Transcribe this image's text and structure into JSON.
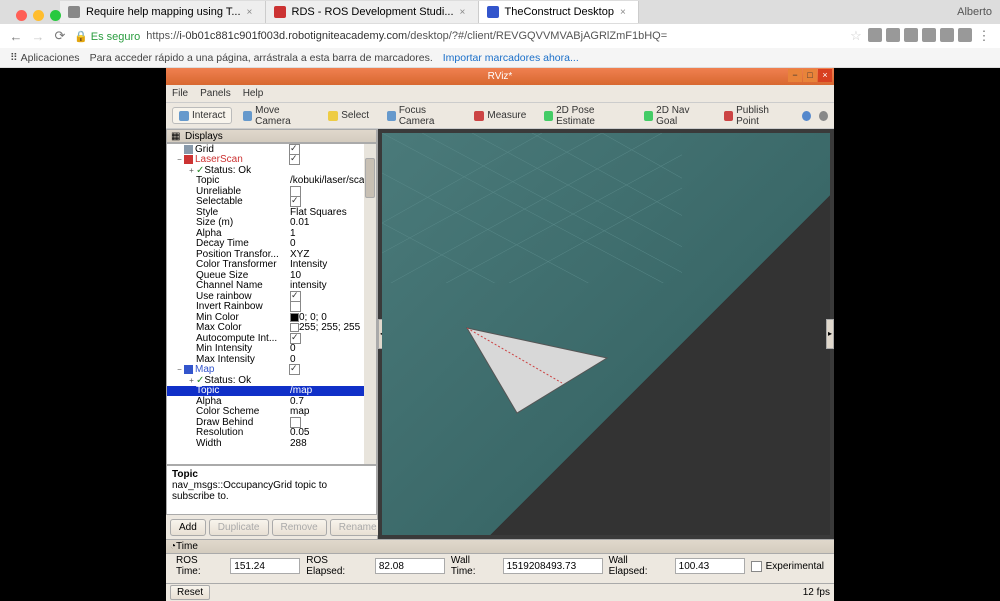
{
  "browser": {
    "user": "Alberto",
    "tabs": [
      {
        "label": "Require help mapping using T..."
      },
      {
        "label": "RDS - ROS Development Studi..."
      },
      {
        "label": "TheConstruct Desktop"
      }
    ],
    "secure_label": "Es seguro",
    "url_prefix": "https://",
    "url_host": "i-0b01c881c901f003d.robotigniteacademy.com",
    "url_path": "/desktop/?#/client/REVGQVVMVABjAGRlZmF1bHQ=",
    "bookmarks_apps": "Aplicaciones",
    "bookmarks_hint": "Para acceder rápido a una página, arrástrala a esta barra de marcadores.",
    "bookmarks_import": "Importar marcadores ahora..."
  },
  "rviz": {
    "title": "RViz*",
    "menus": [
      "File",
      "Panels",
      "Help"
    ],
    "tools": [
      {
        "label": "Interact",
        "color": "#6699cc",
        "active": true
      },
      {
        "label": "Move Camera",
        "color": "#6699cc"
      },
      {
        "label": "Select",
        "color": "#eecc44"
      },
      {
        "label": "Focus Camera",
        "color": "#6699cc"
      },
      {
        "label": "Measure",
        "color": "#cc4444"
      },
      {
        "label": "2D Pose Estimate",
        "color": "#44cc66"
      },
      {
        "label": "2D Nav Goal",
        "color": "#44cc66"
      },
      {
        "label": "Publish Point",
        "color": "#cc4444"
      }
    ],
    "displays_header": "Displays",
    "tree": [
      {
        "indent": 1,
        "label": "Grid",
        "type": "check",
        "checked": true,
        "icon": "#8899aa"
      },
      {
        "indent": 1,
        "label": "LaserScan",
        "type": "check",
        "checked": true,
        "color": "#cc3333",
        "icon": "#cc3333",
        "expander": "−"
      },
      {
        "indent": 2,
        "label": "Status: Ok",
        "type": "status",
        "expander": "+"
      },
      {
        "indent": 2,
        "label": "Topic",
        "value": "/kobuki/laser/scan"
      },
      {
        "indent": 2,
        "label": "Unreliable",
        "type": "check",
        "checked": false
      },
      {
        "indent": 2,
        "label": "Selectable",
        "type": "check",
        "checked": true
      },
      {
        "indent": 2,
        "label": "Style",
        "value": "Flat Squares"
      },
      {
        "indent": 2,
        "label": "Size (m)",
        "value": "0.01"
      },
      {
        "indent": 2,
        "label": "Alpha",
        "value": "1"
      },
      {
        "indent": 2,
        "label": "Decay Time",
        "value": "0"
      },
      {
        "indent": 2,
        "label": "Position Transfor...",
        "value": "XYZ"
      },
      {
        "indent": 2,
        "label": "Color Transformer",
        "value": "Intensity"
      },
      {
        "indent": 2,
        "label": "Queue Size",
        "value": "10"
      },
      {
        "indent": 2,
        "label": "Channel Name",
        "value": "intensity"
      },
      {
        "indent": 2,
        "label": "Use rainbow",
        "type": "check",
        "checked": true
      },
      {
        "indent": 2,
        "label": "Invert Rainbow",
        "type": "check",
        "checked": false
      },
      {
        "indent": 2,
        "label": "Min Color",
        "type": "color",
        "swatch": "#000000",
        "value": "0; 0; 0"
      },
      {
        "indent": 2,
        "label": "Max Color",
        "type": "color",
        "swatch": "#ffffff",
        "value": "255; 255; 255"
      },
      {
        "indent": 2,
        "label": "Autocompute Int...",
        "type": "check",
        "checked": true
      },
      {
        "indent": 2,
        "label": "Min Intensity",
        "value": "0"
      },
      {
        "indent": 2,
        "label": "Max Intensity",
        "value": "0"
      },
      {
        "indent": 1,
        "label": "Map",
        "type": "check",
        "checked": true,
        "color": "#3355cc",
        "icon": "#3355cc",
        "expander": "−"
      },
      {
        "indent": 2,
        "label": "Status: Ok",
        "type": "status",
        "expander": "+"
      },
      {
        "indent": 2,
        "label": "Topic",
        "value": "/map",
        "selected": true
      },
      {
        "indent": 2,
        "label": "Alpha",
        "value": "0.7"
      },
      {
        "indent": 2,
        "label": "Color Scheme",
        "value": "map"
      },
      {
        "indent": 2,
        "label": "Draw Behind",
        "type": "check",
        "checked": false
      },
      {
        "indent": 2,
        "label": "Resolution",
        "value": "0.05"
      },
      {
        "indent": 2,
        "label": "Width",
        "value": "288"
      }
    ],
    "description": {
      "title": "Topic",
      "text": "nav_msgs::OccupancyGrid topic to subscribe to."
    },
    "buttons": {
      "add": "Add",
      "duplicate": "Duplicate",
      "remove": "Remove",
      "rename": "Rename"
    },
    "time": {
      "header": "Time",
      "ros_time_label": "ROS Time:",
      "ros_time": "151.24",
      "ros_elapsed_label": "ROS Elapsed:",
      "ros_elapsed": "82.08",
      "wall_time_label": "Wall Time:",
      "wall_time": "1519208493.73",
      "wall_elapsed_label": "Wall Elapsed:",
      "wall_elapsed": "100.43",
      "experimental": "Experimental"
    },
    "status": {
      "reset": "Reset",
      "fps": "12 fps"
    }
  }
}
